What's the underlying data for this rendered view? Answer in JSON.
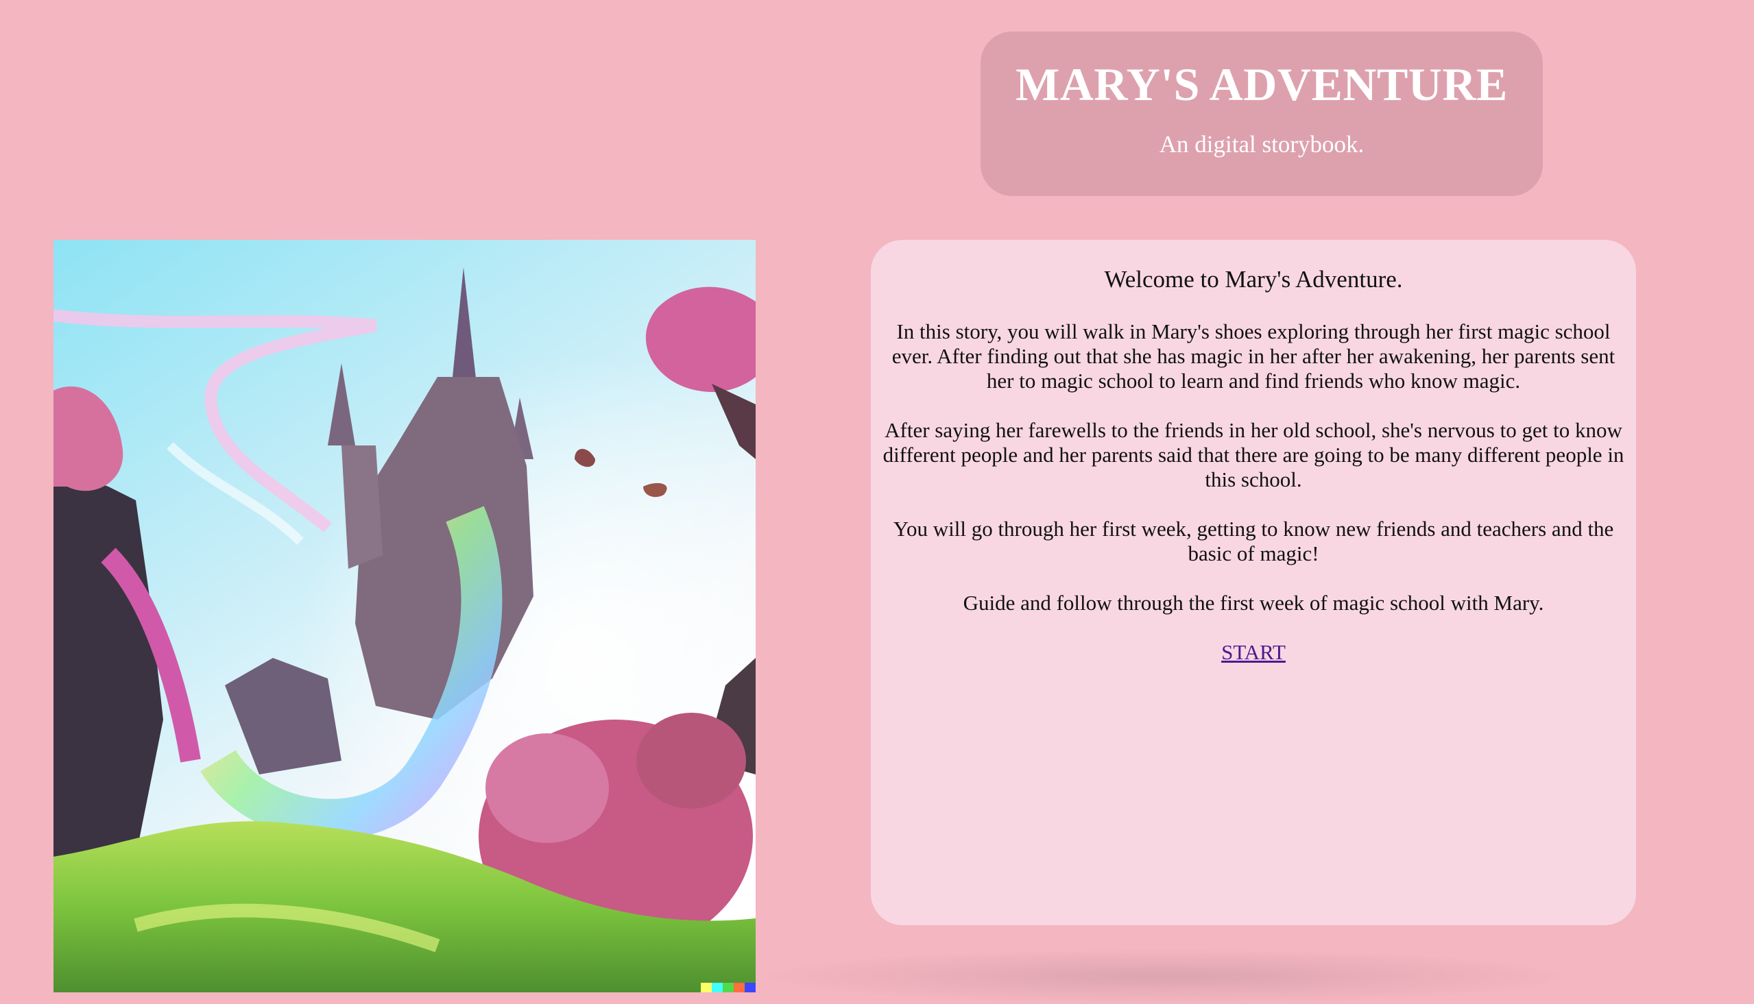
{
  "header": {
    "title": "MARY'S ADVENTURE",
    "subtitle": "An digital storybook."
  },
  "illustration": {
    "description_name": "fantasy-castle-illustration"
  },
  "content": {
    "welcome": "Welcome to Mary's Adventure.",
    "paragraphs": [
      "In this story, you will walk in Mary's shoes exploring through her first magic school ever. After finding out that she has magic in her after her awakening, her parents sent her to magic school to learn and find friends who know magic.",
      "After saying her farewells to the friends in her old school, she's nervous to get to know different people and her parents said that there are going to be many different people in this school.",
      "You will go through her first week, getting to know new friends and teachers and the basic of magic!",
      "Guide and follow through the first week of magic school with Mary."
    ],
    "start_label": "START"
  },
  "colors": {
    "background": "#f4b6c1",
    "header_card": "#dda1ad",
    "content_card": "#f8d7e3",
    "link": "#4b1a8c"
  }
}
